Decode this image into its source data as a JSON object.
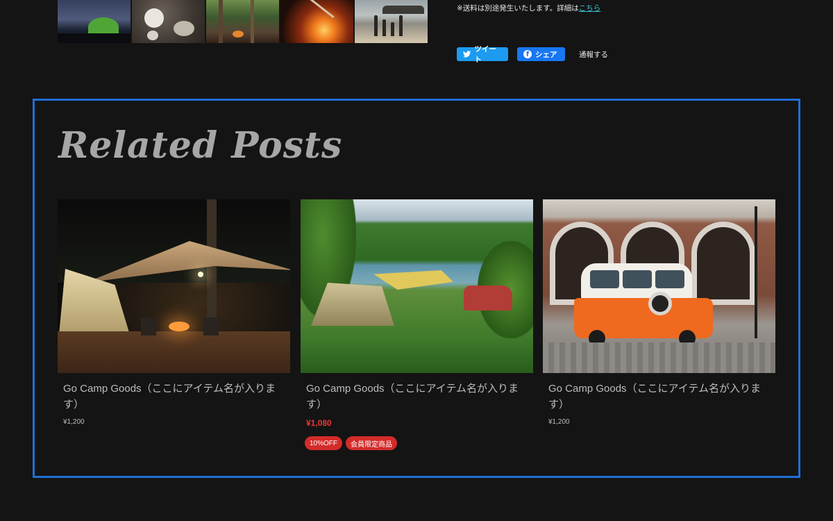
{
  "shipping": {
    "note": "※送料は別途発生いたします。詳細は",
    "link": "こちら"
  },
  "share": {
    "tweet_label": "ツイート",
    "share_label": "シェア",
    "report_label": "通報する",
    "tweet_color": "#1d9bf0",
    "share_color": "#1877f2"
  },
  "related": {
    "title": "Related Posts",
    "border_color": "#1f6fd6",
    "items": [
      {
        "title": "Go Camp Goods（ここにアイテム名が入ります）",
        "price": "¥1,200"
      },
      {
        "title": "Go Camp Goods（ここにアイテム名が入ります）",
        "price": "¥1,080",
        "badges": [
          "10%OFF",
          "会員限定商品"
        ]
      },
      {
        "title": "Go Camp Goods（ここにアイテム名が入ります）",
        "price": "¥1,200"
      }
    ]
  }
}
